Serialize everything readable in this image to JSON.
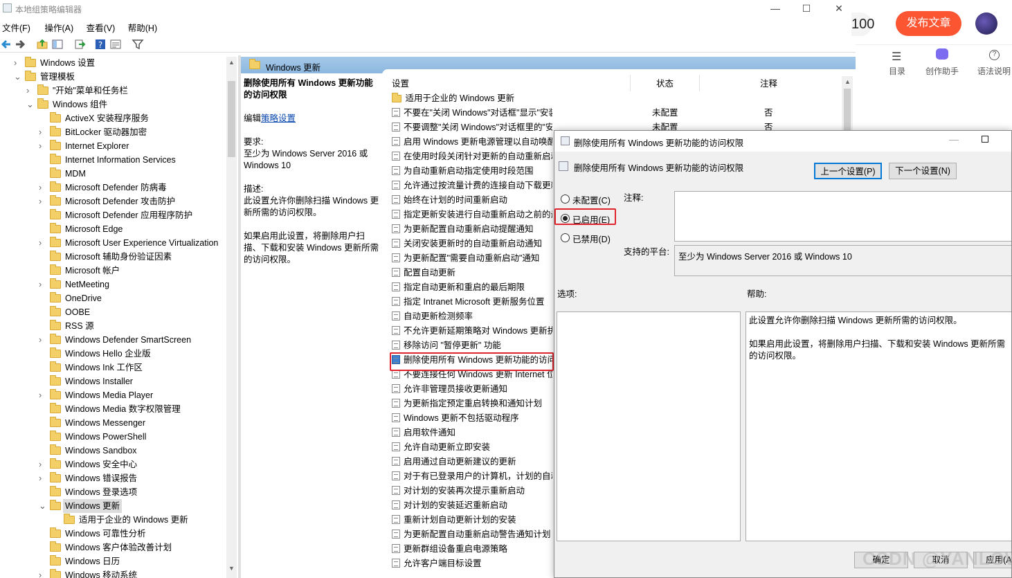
{
  "window": {
    "title": "本地组策略编辑器",
    "minimize": "—",
    "maximize": "☐",
    "close": "✕"
  },
  "menu": [
    "文件(F)",
    "操作(A)",
    "查看(V)",
    "帮助(H)"
  ],
  "tree": [
    {
      "label": "Windows 设置",
      "level": 1,
      "arrow": "›"
    },
    {
      "label": "管理模板",
      "level": 1,
      "arrow": "⌄"
    },
    {
      "label": "\"开始\"菜单和任务栏",
      "level": 2,
      "arrow": "›"
    },
    {
      "label": "Windows 组件",
      "level": 2,
      "arrow": "⌄"
    },
    {
      "label": "ActiveX 安装程序服务",
      "level": 3,
      "arrow": ""
    },
    {
      "label": "BitLocker 驱动器加密",
      "level": 3,
      "arrow": "›"
    },
    {
      "label": "Internet Explorer",
      "level": 3,
      "arrow": "›"
    },
    {
      "label": "Internet Information Services",
      "level": 3,
      "arrow": ""
    },
    {
      "label": "MDM",
      "level": 3,
      "arrow": ""
    },
    {
      "label": "Microsoft Defender 防病毒",
      "level": 3,
      "arrow": "›"
    },
    {
      "label": "Microsoft Defender 攻击防护",
      "level": 3,
      "arrow": "›"
    },
    {
      "label": "Microsoft Defender 应用程序防护",
      "level": 3,
      "arrow": ""
    },
    {
      "label": "Microsoft Edge",
      "level": 3,
      "arrow": ""
    },
    {
      "label": "Microsoft User Experience Virtualization",
      "level": 3,
      "arrow": "›"
    },
    {
      "label": "Microsoft 辅助身份验证因素",
      "level": 3,
      "arrow": ""
    },
    {
      "label": "Microsoft 帐户",
      "level": 3,
      "arrow": ""
    },
    {
      "label": "NetMeeting",
      "level": 3,
      "arrow": "›"
    },
    {
      "label": "OneDrive",
      "level": 3,
      "arrow": ""
    },
    {
      "label": "OOBE",
      "level": 3,
      "arrow": ""
    },
    {
      "label": "RSS 源",
      "level": 3,
      "arrow": ""
    },
    {
      "label": "Windows Defender SmartScreen",
      "level": 3,
      "arrow": "›"
    },
    {
      "label": "Windows Hello 企业版",
      "level": 3,
      "arrow": ""
    },
    {
      "label": "Windows Ink 工作区",
      "level": 3,
      "arrow": ""
    },
    {
      "label": "Windows Installer",
      "level": 3,
      "arrow": ""
    },
    {
      "label": "Windows Media Player",
      "level": 3,
      "arrow": "›"
    },
    {
      "label": "Windows Media 数字权限管理",
      "level": 3,
      "arrow": ""
    },
    {
      "label": "Windows Messenger",
      "level": 3,
      "arrow": ""
    },
    {
      "label": "Windows PowerShell",
      "level": 3,
      "arrow": ""
    },
    {
      "label": "Windows Sandbox",
      "level": 3,
      "arrow": ""
    },
    {
      "label": "Windows 安全中心",
      "level": 3,
      "arrow": "›"
    },
    {
      "label": "Windows 错误报告",
      "level": 3,
      "arrow": "›"
    },
    {
      "label": "Windows 登录选项",
      "level": 3,
      "arrow": ""
    },
    {
      "label": "Windows 更新",
      "level": 3,
      "arrow": "⌄",
      "selected": true
    },
    {
      "label": "适用于企业的 Windows 更新",
      "level": 4,
      "arrow": ""
    },
    {
      "label": "Windows 可靠性分析",
      "level": 3,
      "arrow": ""
    },
    {
      "label": "Windows 客户体验改善计划",
      "level": 3,
      "arrow": ""
    },
    {
      "label": "Windows 日历",
      "level": 3,
      "arrow": ""
    },
    {
      "label": "Windows 移动系统",
      "level": 3,
      "arrow": "›"
    }
  ],
  "detail": {
    "header": "Windows 更新",
    "policy_title": "删除使用所有 Windows 更新功能的访问权限",
    "edit_prefix": "编辑",
    "edit_link": "策略设置",
    "requirements_label": "要求:",
    "requirements": "至少为 Windows Server 2016 或 Windows 10",
    "description_label": "描述:",
    "description": "此设置允许你删除扫描 Windows 更新所需的访问权限。",
    "description2": "如果启用此设置，将删除用户扫描、下载和安装 Windows 更新所需的访问权限。"
  },
  "list": {
    "col_setting": "设置",
    "col_state": "状态",
    "col_comment": "注释",
    "folder_item": "适用于企业的 Windows 更新",
    "items": [
      {
        "name": "不要在\"关闭 Windows\"对话框\"显示\"安装更新并关机\"",
        "state": "未配置",
        "comment": "否"
      },
      {
        "name": "不要调整\"关闭 Windows\"对话框里的\"安装更新并关机\"的默...",
        "state": "未配置",
        "comment": "否"
      },
      {
        "name": "启用 Windows 更新电源管理以自动唤醒",
        "state": "",
        "comment": ""
      },
      {
        "name": "在使用时段关闭针对更新的自动重新启动",
        "state": "",
        "comment": ""
      },
      {
        "name": "为自动重新启动指定使用时段范围",
        "state": "",
        "comment": ""
      },
      {
        "name": "允许通过按流量计费的连接自动下载更新",
        "state": "",
        "comment": ""
      },
      {
        "name": "始终在计划的时间重新启动",
        "state": "",
        "comment": ""
      },
      {
        "name": "指定更新安装进行自动重新启动之前的最",
        "state": "",
        "comment": ""
      },
      {
        "name": "为更新配置自动重新启动提醒通知",
        "state": "",
        "comment": ""
      },
      {
        "name": "关闭安装更新时的自动重新启动通知",
        "state": "",
        "comment": ""
      },
      {
        "name": "为更新配置\"需要自动重新启动\"通知",
        "state": "",
        "comment": ""
      },
      {
        "name": "配置自动更新",
        "state": "",
        "comment": ""
      },
      {
        "name": "指定自动更新和重启的最后期限",
        "state": "",
        "comment": ""
      },
      {
        "name": "指定 Intranet Microsoft 更新服务位置",
        "state": "",
        "comment": ""
      },
      {
        "name": "自动更新检测频率",
        "state": "",
        "comment": ""
      },
      {
        "name": "不允许更新延期策略对 Windows 更新执",
        "state": "",
        "comment": ""
      },
      {
        "name": "移除访问 \"暂停更新\" 功能",
        "state": "",
        "comment": ""
      },
      {
        "name": "删除使用所有 Windows 更新功能的访问",
        "state": "",
        "comment": "",
        "selected": true
      },
      {
        "name": "不要连接任何 Windows 更新 Internet 位",
        "state": "",
        "comment": ""
      },
      {
        "name": "允许非管理员接收更新通知",
        "state": "",
        "comment": ""
      },
      {
        "name": "为更新指定预定重启转换和通知计划",
        "state": "",
        "comment": ""
      },
      {
        "name": "Windows 更新不包括驱动程序",
        "state": "",
        "comment": ""
      },
      {
        "name": "启用软件通知",
        "state": "",
        "comment": ""
      },
      {
        "name": "允许自动更新立即安装",
        "state": "",
        "comment": ""
      },
      {
        "name": "启用通过自动更新建议的更新",
        "state": "",
        "comment": ""
      },
      {
        "name": "对于有已登录用户的计算机，计划的自动",
        "state": "",
        "comment": ""
      },
      {
        "name": "对计划的安装再次提示重新启动",
        "state": "",
        "comment": ""
      },
      {
        "name": "对计划的安装延迟重新启动",
        "state": "",
        "comment": ""
      },
      {
        "name": "重新计划自动更新计划的安装",
        "state": "",
        "comment": ""
      },
      {
        "name": "为更新配置自动重新启动警告通知计划",
        "state": "",
        "comment": ""
      },
      {
        "name": "更新群组设备重启电源策略",
        "state": "",
        "comment": ""
      },
      {
        "name": "允许客户端目标设置",
        "state": "",
        "comment": ""
      }
    ]
  },
  "dialog": {
    "title": "删除使用所有 Windows 更新功能的访问权限",
    "subtitle": "删除使用所有 Windows 更新功能的访问权限",
    "prev_button": "上一个设置(P)",
    "next_button": "下一个设置(N)",
    "radio_not_configured": "未配置(C)",
    "radio_enabled": "已启用(E)",
    "radio_disabled": "已禁用(D)",
    "selected_option": "已启用(E)",
    "comment_label": "注释:",
    "comment_value": "",
    "supported_label": "支持的平台:",
    "supported_value": "至少为 Windows Server 2016 或 Windows 10",
    "options_label": "选项:",
    "help_label": "帮助:",
    "help_text_1": "此设置允许你删除扫描 Windows 更新所需的访问权限。",
    "help_text_2": "如果启用此设置，将删除用户扫描、下载和安装 Windows 更新所需的访问权限。",
    "ok_button": "确定",
    "cancel_button": "取消",
    "apply_button": "应用(A)"
  },
  "csdn": {
    "count": "100",
    "publish_button": "发布文章",
    "tools": [
      "目录",
      "创作助手",
      "语法说明"
    ],
    "accent": "#fc5531"
  },
  "watermark": "CSDN @YANLOWL",
  "colors": {
    "highlight": "#e0232d",
    "header": "#9ec3e6",
    "folder": "#f3cf68"
  }
}
